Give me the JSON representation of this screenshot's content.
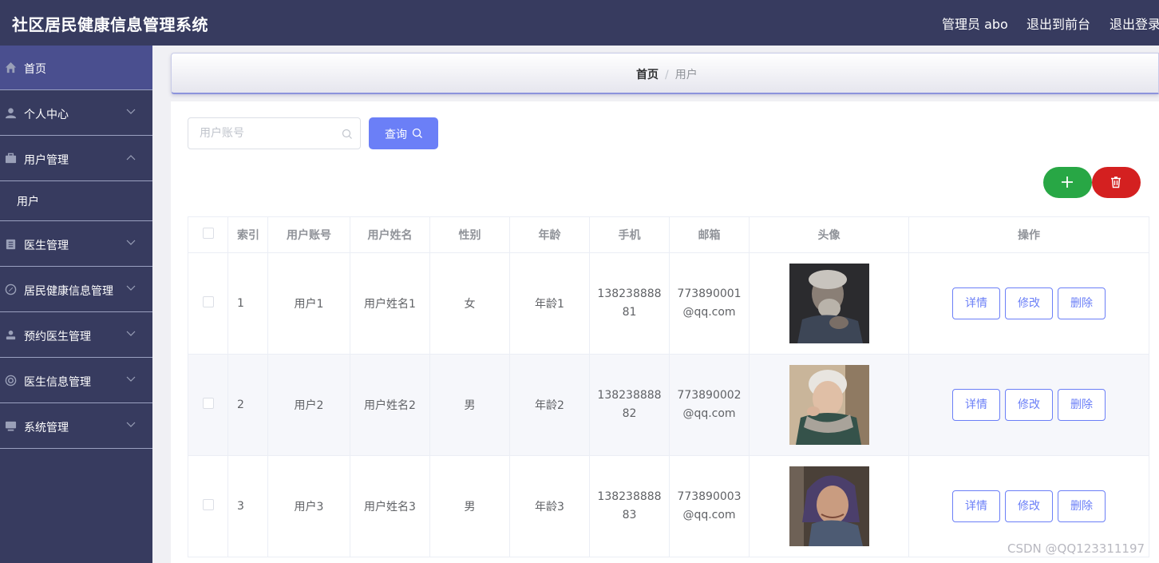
{
  "header": {
    "title": "社区居民健康信息管理系统",
    "user": "管理员 abo",
    "to_front": "退出到前台",
    "logout": "退出登录"
  },
  "sidebar": {
    "items": [
      {
        "label": "首页",
        "icon": "home-icon"
      },
      {
        "label": "个人中心",
        "icon": "user-icon"
      },
      {
        "label": "用户管理",
        "icon": "briefcase-icon",
        "expanded": true,
        "children": [
          {
            "label": "用户"
          }
        ]
      },
      {
        "label": "医生管理",
        "icon": "clipboard-icon"
      },
      {
        "label": "居民健康信息管理",
        "icon": "compass-icon"
      },
      {
        "label": "预约医生管理",
        "icon": "person-icon"
      },
      {
        "label": "医生信息管理",
        "icon": "lifebuoy-icon"
      },
      {
        "label": "系统管理",
        "icon": "monitor-icon"
      }
    ]
  },
  "breadcrumb": {
    "home": "首页",
    "separator": "/",
    "current": "用户"
  },
  "search": {
    "placeholder": "用户账号",
    "value": "",
    "button": "查询"
  },
  "table": {
    "columns": [
      "索引",
      "用户账号",
      "用户姓名",
      "性别",
      "年龄",
      "手机",
      "邮箱",
      "头像",
      "操作"
    ],
    "rows": [
      {
        "index": "1",
        "account": "用户1",
        "name": "用户姓名1",
        "gender": "女",
        "age": "年龄1",
        "phone": "13823888881",
        "email": "773890001@qq.com"
      },
      {
        "index": "2",
        "account": "用户2",
        "name": "用户姓名2",
        "gender": "男",
        "age": "年龄2",
        "phone": "13823888882",
        "email": "773890002@qq.com"
      },
      {
        "index": "3",
        "account": "用户3",
        "name": "用户姓名3",
        "gender": "男",
        "age": "年龄3",
        "phone": "13823888883",
        "email": "773890003@qq.com"
      }
    ],
    "actions": {
      "detail": "详情",
      "edit": "修改",
      "delete": "删除"
    }
  },
  "watermark": "CSDN @QQ123311197",
  "colors": {
    "sidebar": "#373b5f",
    "primary": "#6b7ff7",
    "add": "#28a745",
    "delete": "#d42020"
  }
}
